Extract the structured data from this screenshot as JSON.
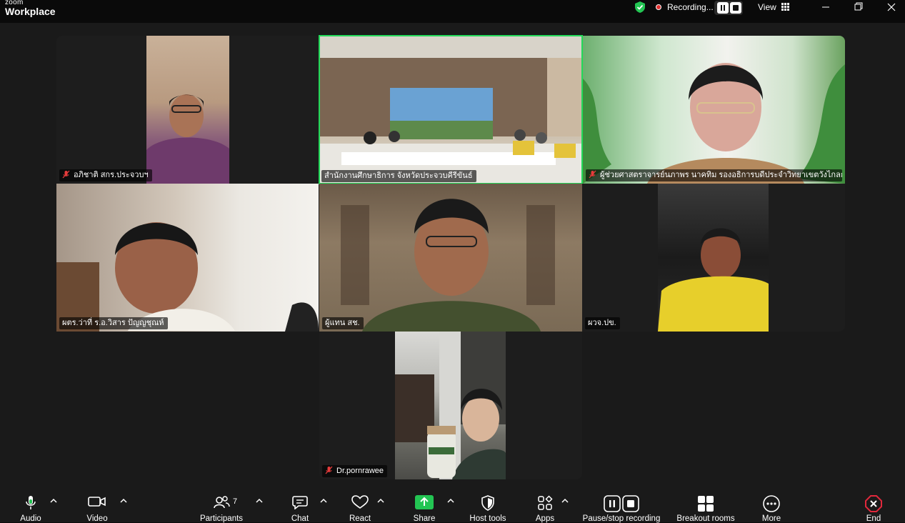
{
  "app": {
    "brand_small": "zoom",
    "brand_big": "Workplace"
  },
  "recording": {
    "label": "Recording...",
    "color": "#e02f2f"
  },
  "view_label": "View",
  "participants": [
    {
      "name": "อภิชาติ สกร.ประจวบฯ",
      "muted": true
    },
    {
      "name": "สำนักงานศึกษาธิการ จังหวัดประจวบคีรีขันธ์",
      "muted": false,
      "active_speaker": true
    },
    {
      "name": "ผู้ช่วยศาสตราจารย์นภาพร  นาคทิม  รองอธิการบดีประจำวิทยาเขตวังไกลกังวล",
      "muted": true
    },
    {
      "name": "ผตร.ว่าที่ ร.อ.วิสาร ปัญญชุณห์",
      "muted": false
    },
    {
      "name": "ผู้แทน สช.",
      "muted": false
    },
    {
      "name": "ผวจ.ปข.",
      "muted": false
    },
    {
      "name": "Dr.pornrawee",
      "muted": true
    }
  ],
  "toolbar": {
    "audio": "Audio",
    "video": "Video",
    "participants": "Participants",
    "participants_count": "7",
    "chat": "Chat",
    "react": "React",
    "share": "Share",
    "host_tools": "Host tools",
    "apps": "Apps",
    "pause_stop_recording": "Pause/stop recording",
    "breakout_rooms": "Breakout rooms",
    "more": "More",
    "end": "End"
  },
  "colors": {
    "active_speaker_border": "#23d959",
    "share_green": "#23c553",
    "end_red": "#e0283c",
    "mic_green": "#23c553"
  }
}
